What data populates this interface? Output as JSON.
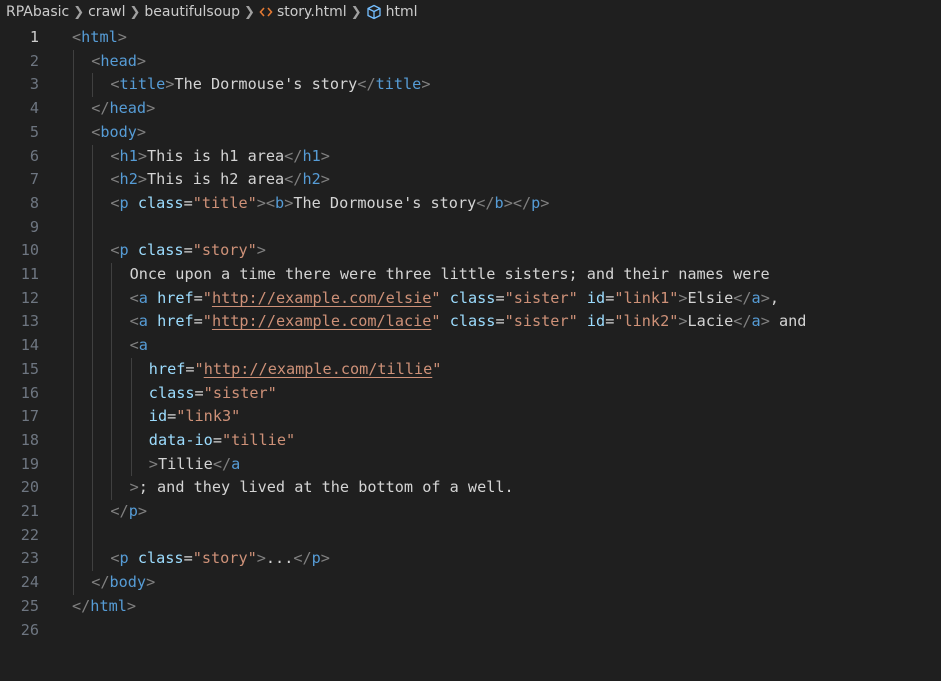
{
  "breadcrumb": {
    "items": [
      "RPAbasic",
      "crawl",
      "beautifulsoup",
      "story.html",
      "html"
    ],
    "separator": ">"
  },
  "colors": {
    "background": "#1f1f1f",
    "tag": "#569cd6",
    "attribute": "#9cdcfe",
    "string": "#ce9178",
    "text": "#d4d4d4",
    "bracket": "#808080",
    "line_number": "#6e7681"
  },
  "editor": {
    "active_line": 1,
    "lines": [
      {
        "n": "1",
        "indent": 0,
        "tokens": [
          [
            "b",
            "<"
          ],
          [
            "t",
            "html"
          ],
          [
            "b",
            ">"
          ]
        ]
      },
      {
        "n": "2",
        "indent": 1,
        "tokens": [
          [
            "b",
            "<"
          ],
          [
            "t",
            "head"
          ],
          [
            "b",
            ">"
          ]
        ]
      },
      {
        "n": "3",
        "indent": 2,
        "tokens": [
          [
            "b",
            "<"
          ],
          [
            "t",
            "title"
          ],
          [
            "b",
            ">"
          ],
          [
            "x",
            "The Dormouse's story"
          ],
          [
            "b",
            "</"
          ],
          [
            "t",
            "title"
          ],
          [
            "b",
            ">"
          ]
        ]
      },
      {
        "n": "4",
        "indent": 1,
        "tokens": [
          [
            "b",
            "</"
          ],
          [
            "t",
            "head"
          ],
          [
            "b",
            ">"
          ]
        ]
      },
      {
        "n": "5",
        "indent": 1,
        "tokens": [
          [
            "b",
            "<"
          ],
          [
            "t",
            "body"
          ],
          [
            "b",
            ">"
          ]
        ]
      },
      {
        "n": "6",
        "indent": 2,
        "tokens": [
          [
            "b",
            "<"
          ],
          [
            "t",
            "h1"
          ],
          [
            "b",
            ">"
          ],
          [
            "x",
            "This is h1 area"
          ],
          [
            "b",
            "</"
          ],
          [
            "t",
            "h1"
          ],
          [
            "b",
            ">"
          ]
        ]
      },
      {
        "n": "7",
        "indent": 2,
        "tokens": [
          [
            "b",
            "<"
          ],
          [
            "t",
            "h2"
          ],
          [
            "b",
            ">"
          ],
          [
            "x",
            "This is h2 area"
          ],
          [
            "b",
            "</"
          ],
          [
            "t",
            "h2"
          ],
          [
            "b",
            ">"
          ]
        ]
      },
      {
        "n": "8",
        "indent": 2,
        "tokens": [
          [
            "b",
            "<"
          ],
          [
            "t",
            "p"
          ],
          [
            "x",
            " "
          ],
          [
            "a",
            "class"
          ],
          [
            "x",
            "="
          ],
          [
            "s",
            "\"title\""
          ],
          [
            "b",
            "><"
          ],
          [
            "t",
            "b"
          ],
          [
            "b",
            ">"
          ],
          [
            "x",
            "The Dormouse's story"
          ],
          [
            "b",
            "</"
          ],
          [
            "t",
            "b"
          ],
          [
            "b",
            "></"
          ],
          [
            "t",
            "p"
          ],
          [
            "b",
            ">"
          ]
        ]
      },
      {
        "n": "9",
        "indent": 0,
        "tokens": []
      },
      {
        "n": "10",
        "indent": 2,
        "tokens": [
          [
            "b",
            "<"
          ],
          [
            "t",
            "p"
          ],
          [
            "x",
            " "
          ],
          [
            "a",
            "class"
          ],
          [
            "x",
            "="
          ],
          [
            "s",
            "\"story\""
          ],
          [
            "b",
            ">"
          ]
        ]
      },
      {
        "n": "11",
        "indent": 3,
        "tokens": [
          [
            "x",
            "Once upon a time there were three little sisters; and their names were"
          ]
        ]
      },
      {
        "n": "12",
        "indent": 3,
        "tokens": [
          [
            "b",
            "<"
          ],
          [
            "t",
            "a"
          ],
          [
            "x",
            " "
          ],
          [
            "a",
            "href"
          ],
          [
            "x",
            "="
          ],
          [
            "s",
            "\""
          ],
          [
            "u",
            "http://example.com/elsie"
          ],
          [
            "s",
            "\""
          ],
          [
            "x",
            " "
          ],
          [
            "a",
            "class"
          ],
          [
            "x",
            "="
          ],
          [
            "s",
            "\"sister\""
          ],
          [
            "x",
            " "
          ],
          [
            "a",
            "id"
          ],
          [
            "x",
            "="
          ],
          [
            "s",
            "\"link1\""
          ],
          [
            "b",
            ">"
          ],
          [
            "x",
            "Elsie"
          ],
          [
            "b",
            "</"
          ],
          [
            "t",
            "a"
          ],
          [
            "b",
            ">"
          ],
          [
            "x",
            ","
          ]
        ]
      },
      {
        "n": "13",
        "indent": 3,
        "tokens": [
          [
            "b",
            "<"
          ],
          [
            "t",
            "a"
          ],
          [
            "x",
            " "
          ],
          [
            "a",
            "href"
          ],
          [
            "x",
            "="
          ],
          [
            "s",
            "\""
          ],
          [
            "u",
            "http://example.com/lacie"
          ],
          [
            "s",
            "\""
          ],
          [
            "x",
            " "
          ],
          [
            "a",
            "class"
          ],
          [
            "x",
            "="
          ],
          [
            "s",
            "\"sister\""
          ],
          [
            "x",
            " "
          ],
          [
            "a",
            "id"
          ],
          [
            "x",
            "="
          ],
          [
            "s",
            "\"link2\""
          ],
          [
            "b",
            ">"
          ],
          [
            "x",
            "Lacie"
          ],
          [
            "b",
            "</"
          ],
          [
            "t",
            "a"
          ],
          [
            "b",
            ">"
          ],
          [
            "x",
            " and"
          ]
        ]
      },
      {
        "n": "14",
        "indent": 3,
        "tokens": [
          [
            "b",
            "<"
          ],
          [
            "t",
            "a"
          ]
        ]
      },
      {
        "n": "15",
        "indent": 4,
        "tokens": [
          [
            "a",
            "href"
          ],
          [
            "x",
            "="
          ],
          [
            "s",
            "\""
          ],
          [
            "u",
            "http://example.com/tillie"
          ],
          [
            "s",
            "\""
          ]
        ]
      },
      {
        "n": "16",
        "indent": 4,
        "tokens": [
          [
            "a",
            "class"
          ],
          [
            "x",
            "="
          ],
          [
            "s",
            "\"sister\""
          ]
        ]
      },
      {
        "n": "17",
        "indent": 4,
        "tokens": [
          [
            "a",
            "id"
          ],
          [
            "x",
            "="
          ],
          [
            "s",
            "\"link3\""
          ]
        ]
      },
      {
        "n": "18",
        "indent": 4,
        "tokens": [
          [
            "a",
            "data-io"
          ],
          [
            "x",
            "="
          ],
          [
            "s",
            "\"tillie\""
          ]
        ]
      },
      {
        "n": "19",
        "indent": 4,
        "tokens": [
          [
            "b",
            ">"
          ],
          [
            "x",
            "Tillie"
          ],
          [
            "b",
            "</"
          ],
          [
            "t",
            "a"
          ]
        ]
      },
      {
        "n": "20",
        "indent": 3,
        "tokens": [
          [
            "b",
            ">"
          ],
          [
            "x",
            "; and they lived at the bottom of a well."
          ]
        ]
      },
      {
        "n": "21",
        "indent": 2,
        "tokens": [
          [
            "b",
            "</"
          ],
          [
            "t",
            "p"
          ],
          [
            "b",
            ">"
          ]
        ]
      },
      {
        "n": "22",
        "indent": 0,
        "tokens": []
      },
      {
        "n": "23",
        "indent": 2,
        "tokens": [
          [
            "b",
            "<"
          ],
          [
            "t",
            "p"
          ],
          [
            "x",
            " "
          ],
          [
            "a",
            "class"
          ],
          [
            "x",
            "="
          ],
          [
            "s",
            "\"story\""
          ],
          [
            "b",
            ">"
          ],
          [
            "x",
            "..."
          ],
          [
            "b",
            "</"
          ],
          [
            "t",
            "p"
          ],
          [
            "b",
            ">"
          ]
        ]
      },
      {
        "n": "24",
        "indent": 1,
        "tokens": [
          [
            "b",
            "</"
          ],
          [
            "t",
            "body"
          ],
          [
            "b",
            ">"
          ]
        ]
      },
      {
        "n": "25",
        "indent": 0,
        "tokens": [
          [
            "b",
            "</"
          ],
          [
            "t",
            "html"
          ],
          [
            "b",
            ">"
          ]
        ]
      },
      {
        "n": "26",
        "indent": 0,
        "tokens": []
      }
    ]
  }
}
